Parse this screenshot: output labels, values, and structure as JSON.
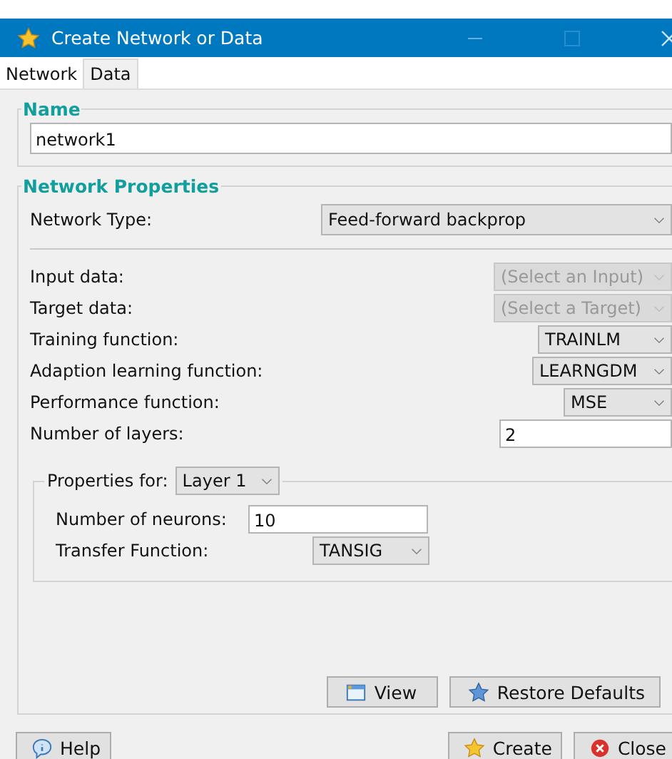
{
  "window": {
    "title": "Create Network or Data"
  },
  "tabs": [
    {
      "label": "Network",
      "selected": true
    },
    {
      "label": "Data",
      "selected": false
    }
  ],
  "name_group": {
    "legend": "Name",
    "value": "network1"
  },
  "properties": {
    "legend": "Network Properties",
    "network_type": {
      "label": "Network Type:",
      "value": "Feed-forward backprop"
    },
    "fields": [
      {
        "label": "Input data:",
        "kind": "dropdown",
        "value": "(Select an Input)",
        "disabled": true
      },
      {
        "label": "Target data:",
        "kind": "dropdown",
        "value": "(Select a Target)",
        "disabled": true
      },
      {
        "label": "Training function:",
        "kind": "dropdown",
        "value": "TRAINLM",
        "disabled": false
      },
      {
        "label": "Adaption learning function:",
        "kind": "dropdown",
        "value": "LEARNGDM",
        "disabled": false
      },
      {
        "label": "Performance function:",
        "kind": "dropdown",
        "value": "MSE",
        "disabled": false
      },
      {
        "label": "Number of layers:",
        "kind": "input",
        "value": "2",
        "disabled": false
      }
    ],
    "layer_group": {
      "label": "Properties for:",
      "layer": "Layer 1",
      "fields": [
        {
          "label": "Number of neurons:",
          "kind": "input",
          "value": "10"
        },
        {
          "label": "Transfer Function:",
          "kind": "dropdown",
          "value": "TANSIG"
        }
      ]
    },
    "buttons": [
      {
        "label": "View",
        "kind": "view"
      },
      {
        "label": "Restore Defaults",
        "kind": "restore"
      }
    ]
  },
  "footer": {
    "left": [
      {
        "label": "Help",
        "kind": "help"
      }
    ],
    "right": [
      {
        "label": "Create",
        "kind": "create"
      },
      {
        "label": "Close",
        "kind": "close"
      }
    ]
  }
}
